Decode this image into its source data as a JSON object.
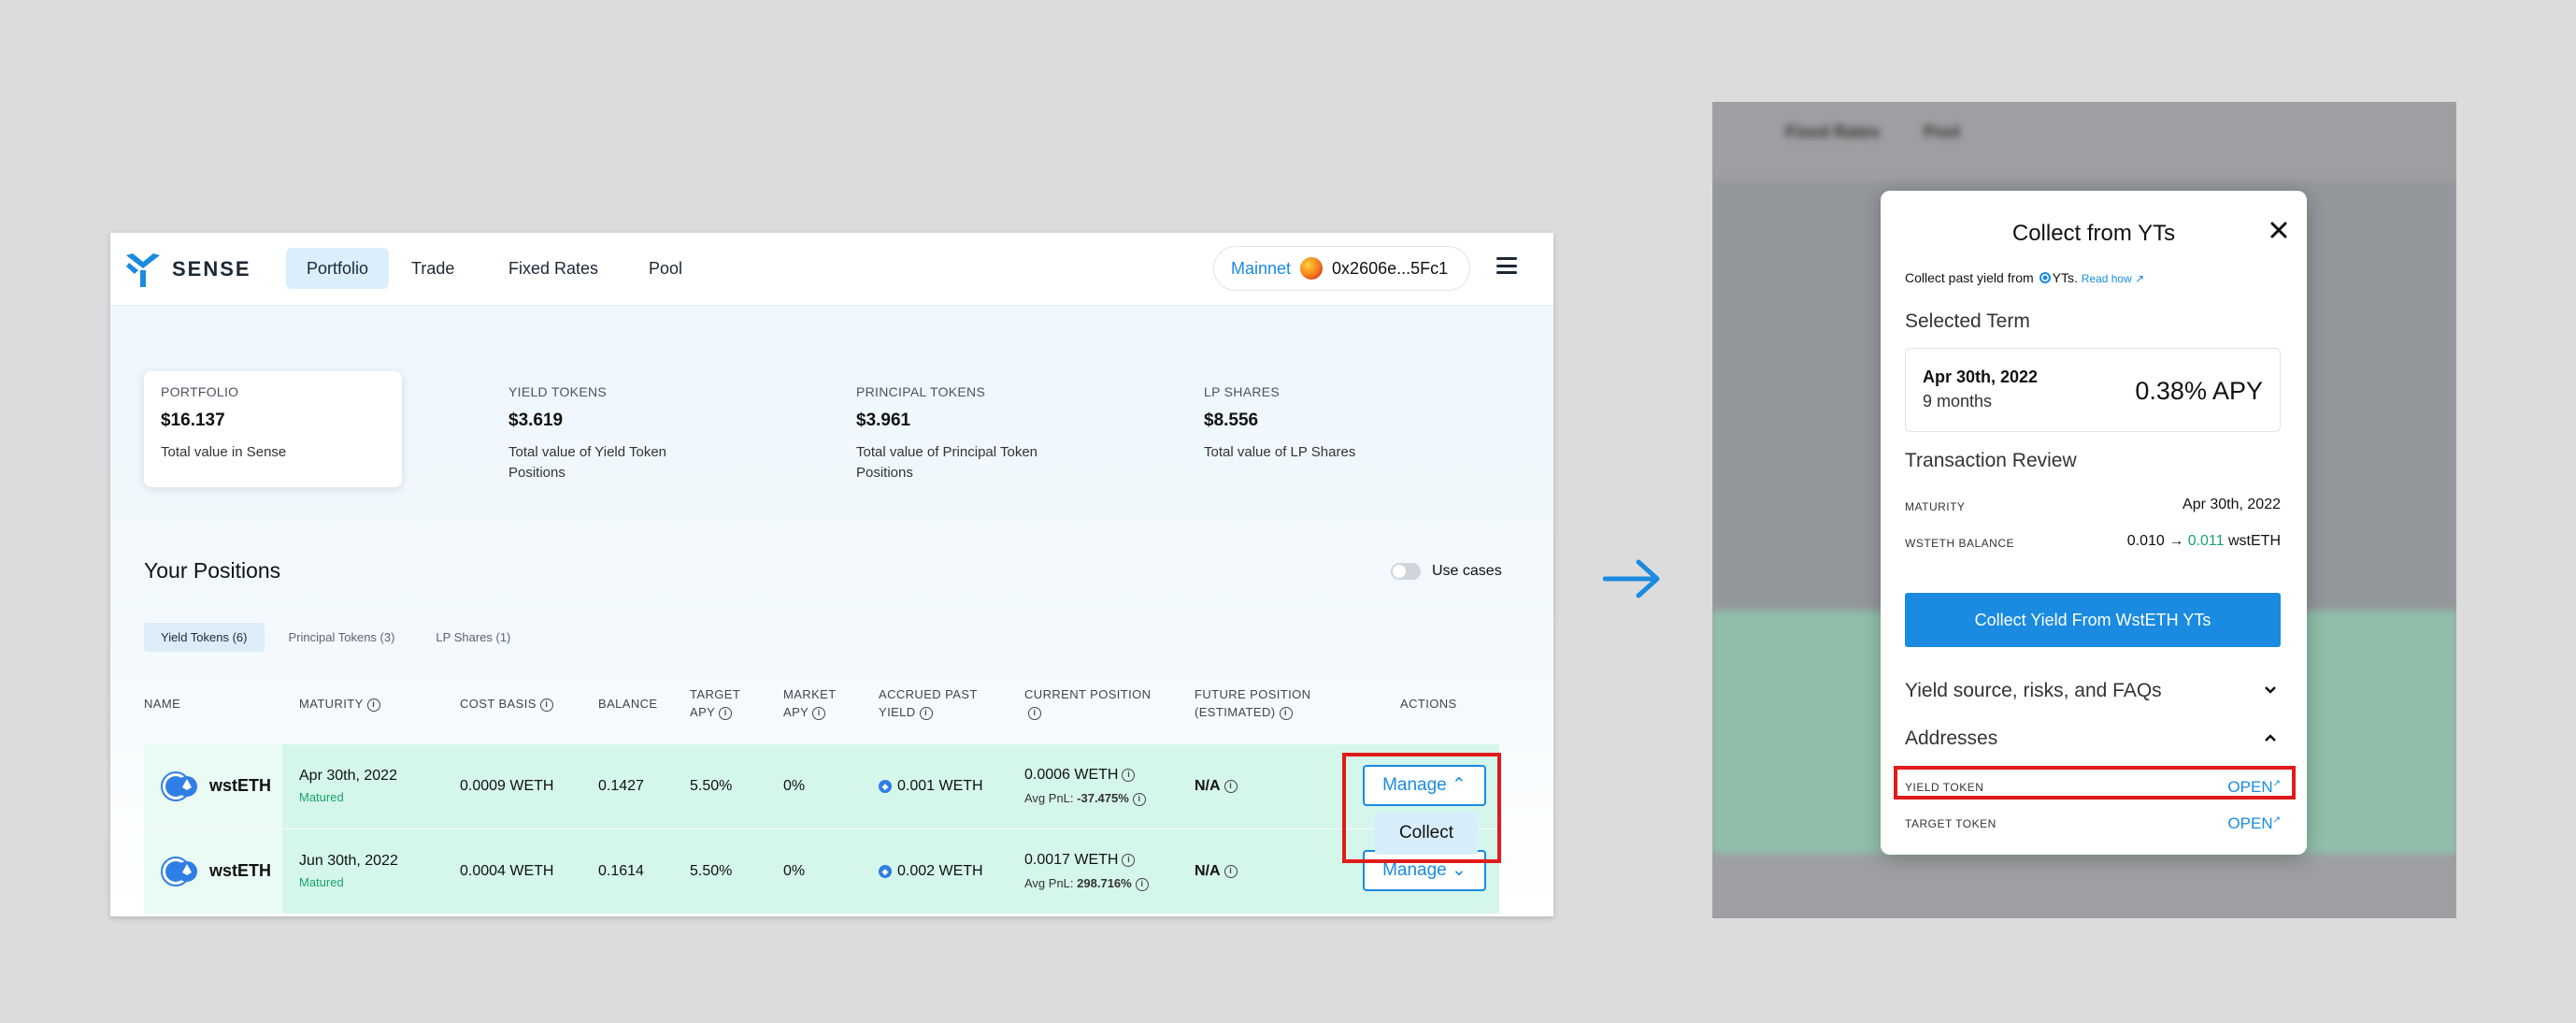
{
  "nav": {
    "brand": "SENSE",
    "items": [
      "Portfolio",
      "Trade",
      "Fixed Rates",
      "Pool"
    ],
    "active": "Portfolio",
    "network": "Mainnet",
    "address": "0x2606e...5Fc1"
  },
  "stats": [
    {
      "label": "PORTFOLIO",
      "value": "$16.137",
      "desc": "Total value in Sense"
    },
    {
      "label": "YIELD TOKENS",
      "value": "$3.619",
      "desc": "Total value of Yield Token Positions"
    },
    {
      "label": "PRINCIPAL TOKENS",
      "value": "$3.961",
      "desc": "Total value of Principal Token Positions"
    },
    {
      "label": "LP SHARES",
      "value": "$8.556",
      "desc": "Total value of LP Shares"
    }
  ],
  "positions": {
    "title": "Your Positions",
    "use_cases": "Use cases",
    "tabs": [
      "Yield Tokens (6)",
      "Principal Tokens (3)",
      "LP Shares (1)"
    ],
    "headers": {
      "name": "NAME",
      "maturity": "MATURITY",
      "cost_basis": "COST BASIS",
      "balance": "BALANCE",
      "target_apy": "TARGET APY",
      "market_apy": "MARKET APY",
      "accrued": "ACCRUED PAST YIELD",
      "current": "CURRENT POSITION",
      "future": "FUTURE POSITION (ESTIMATED)",
      "actions": "ACTIONS"
    },
    "rows": [
      {
        "token": "wstETH",
        "maturity": "Apr 30th, 2022",
        "status": "Matured",
        "cost_basis": "0.0009 WETH",
        "balance": "0.1427",
        "target_apy": "5.50%",
        "market_apy": "0%",
        "accrued": "0.001 WETH",
        "current": "0.0006 WETH",
        "pnl_label": "Avg PnL:",
        "pnl": "-37.475%",
        "future": "N/A",
        "action": "Manage"
      },
      {
        "token": "wstETH",
        "maturity": "Jun 30th, 2022",
        "status": "Matured",
        "cost_basis": "0.0004 WETH",
        "balance": "0.1614",
        "target_apy": "5.50%",
        "market_apy": "0%",
        "accrued": "0.002 WETH",
        "current": "0.0017 WETH",
        "pnl_label": "Avg PnL:",
        "pnl": "298.716%",
        "future": "N/A",
        "action": "Manage"
      }
    ],
    "dropdown_item": "Collect"
  },
  "background": {
    "nav": [
      "Fixed Rates",
      "Pool"
    ]
  },
  "modal": {
    "title": "Collect from YTs",
    "subtitle_prefix": "Collect past yield from",
    "subtitle_suffix": "YTs.",
    "read_how": "Read how",
    "selected_term_heading": "Selected Term",
    "term_date": "Apr 30th, 2022",
    "term_duration": "9 months",
    "term_apy": "0.38% APY",
    "review_heading": "Transaction Review",
    "maturity_label": "MATURITY",
    "maturity_value": "Apr 30th, 2022",
    "balance_label": "WSTETH BALANCE",
    "balance_from": "0.010",
    "balance_to": "0.011",
    "balance_unit": "wstETH",
    "collect_button": "Collect Yield From WstETH YTs",
    "faq_label": "Yield source, risks, and FAQs",
    "addresses_label": "Addresses",
    "yield_token_label": "YIELD TOKEN",
    "target_token_label": "TARGET TOKEN",
    "open_label": "OPEN"
  },
  "colors": {
    "accent": "#1a8be0",
    "highlight": "#e01b1b",
    "row_bg": "#d5f6ea",
    "matured": "#1aa36b"
  }
}
